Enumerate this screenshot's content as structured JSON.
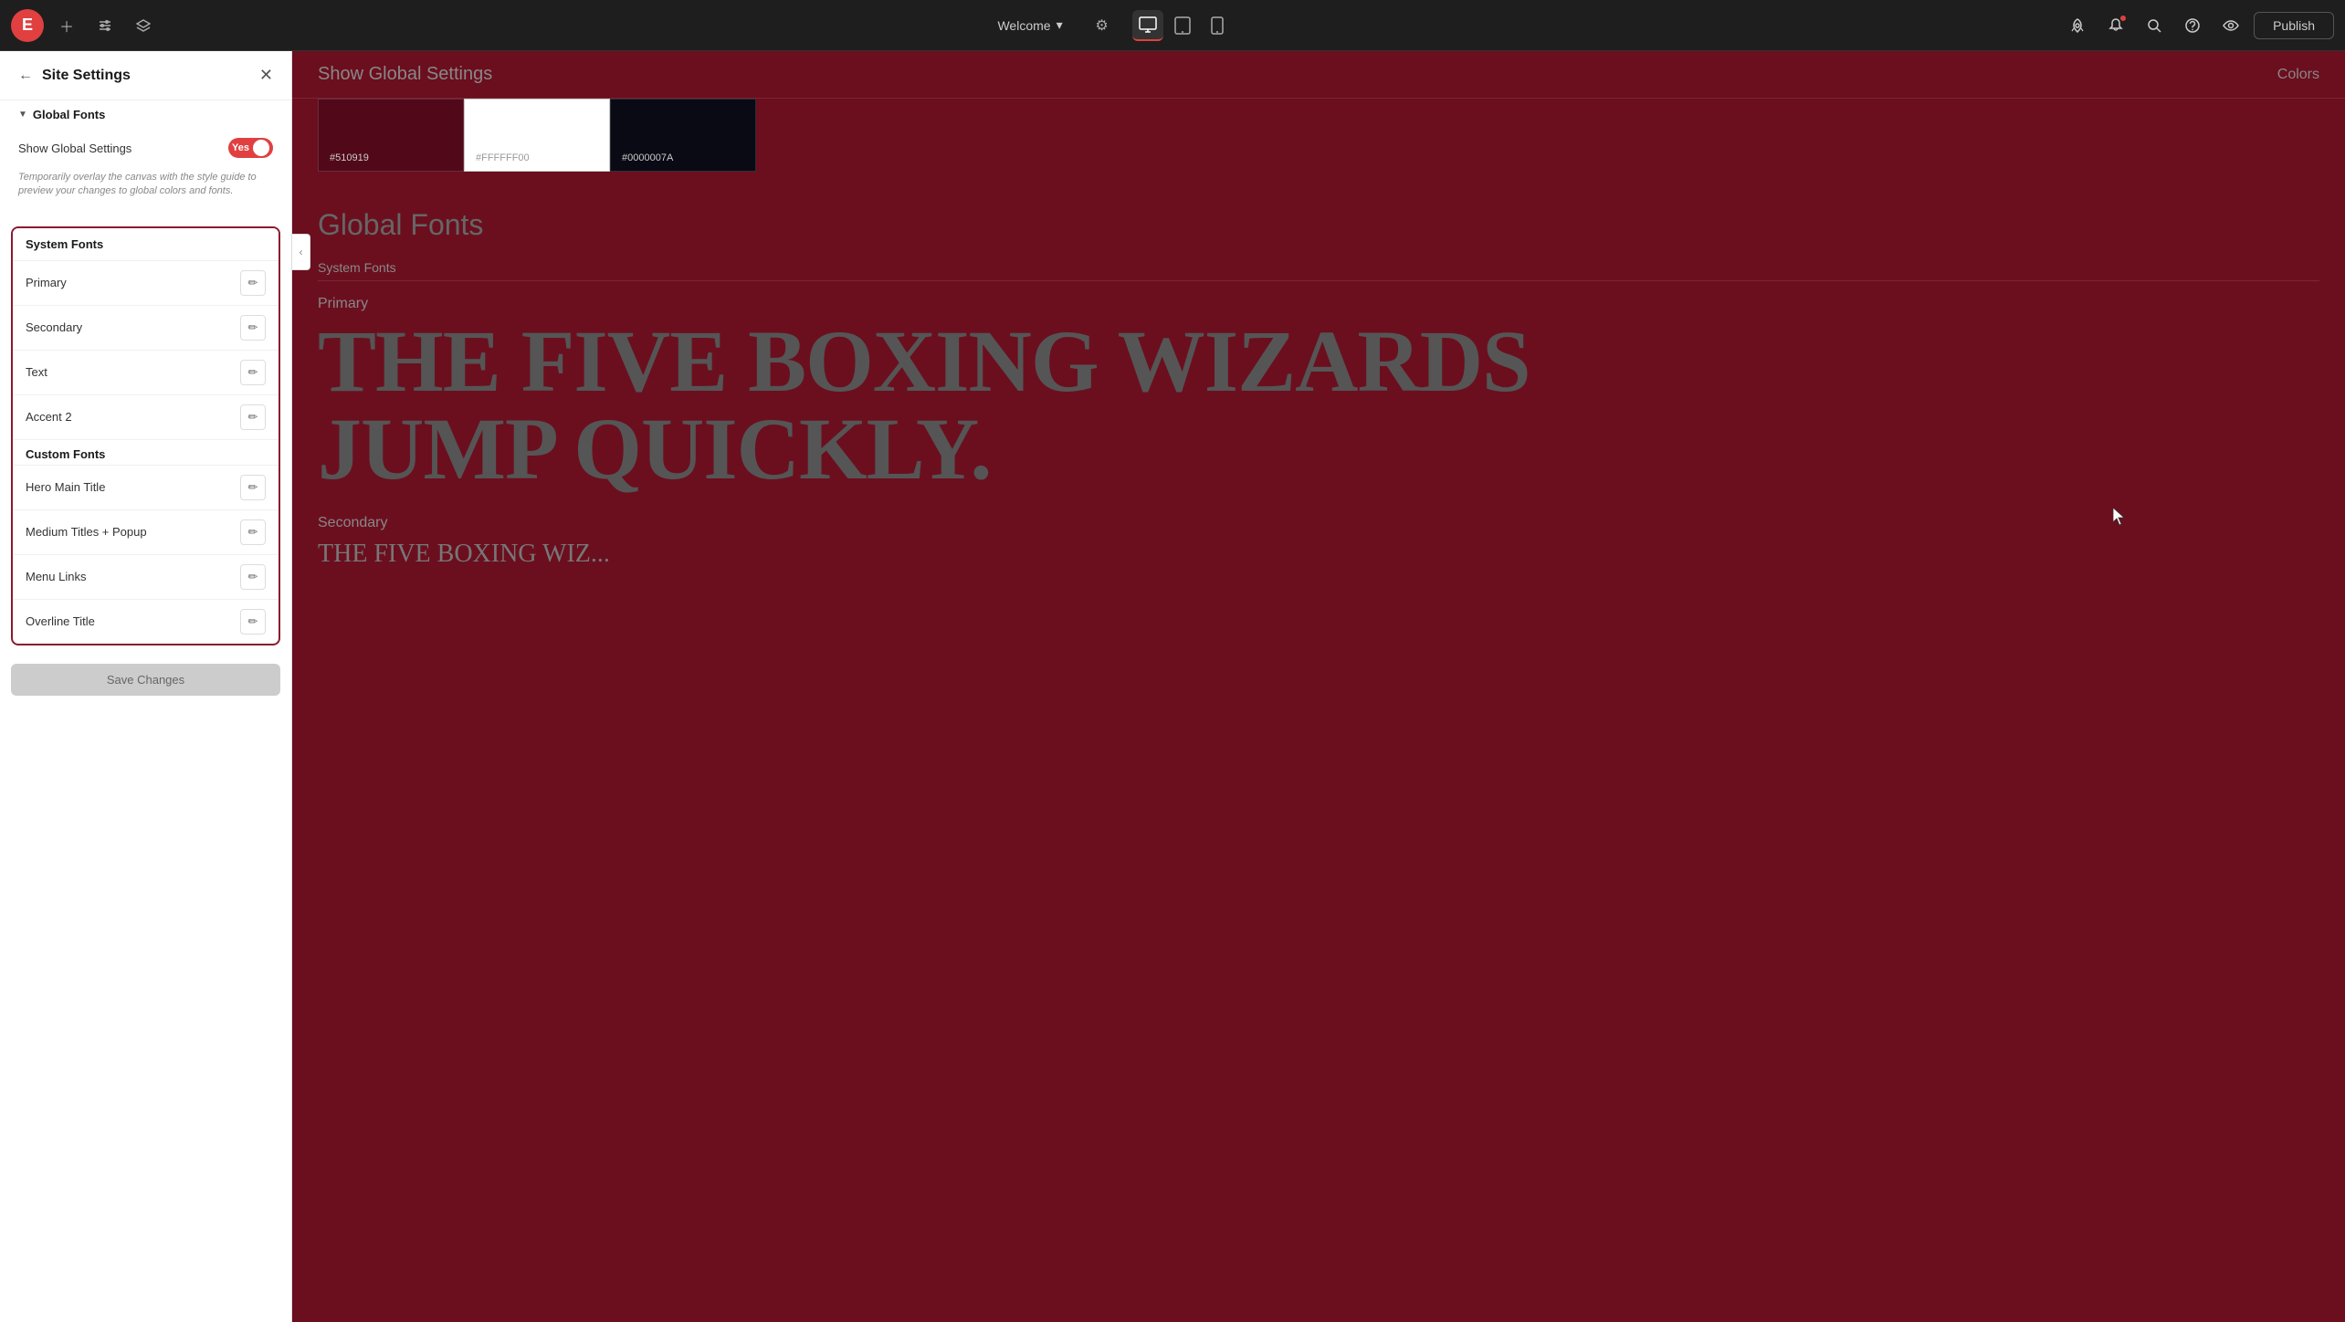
{
  "topbar": {
    "logo_icon": "E",
    "welcome_label": "Welcome",
    "publish_label": "Publish",
    "device_modes": [
      "desktop",
      "tablet",
      "mobile"
    ]
  },
  "sidebar": {
    "title": "Site Settings",
    "show_global_settings_title": "Show Global Settings",
    "show_global_toggle": "Yes",
    "toggle_hint": "Temporarily overlay the canvas with the style guide to preview your changes to global colors and fonts.",
    "global_fonts_section_label": "Global Fonts",
    "system_fonts_label": "System Fonts",
    "custom_fonts_label": "Custom Fonts",
    "system_fonts": [
      {
        "name": "Primary"
      },
      {
        "name": "Secondary"
      },
      {
        "name": "Text"
      },
      {
        "name": "Accent 2"
      }
    ],
    "custom_fonts": [
      {
        "name": "Hero Main Title"
      },
      {
        "name": "Medium Titles + Popup"
      },
      {
        "name": "Menu Links"
      },
      {
        "name": "Overline Title"
      }
    ],
    "save_btn_label": "Save Changes"
  },
  "canvas": {
    "header_title": "Show Global Settings",
    "colors_link": "Colors",
    "color_swatches": [
      {
        "label": "#510919",
        "bg": "#510919"
      },
      {
        "label": "#FFFFFF00",
        "bg": "#ffffff"
      },
      {
        "label": "#0000007A",
        "bg": "#0a0a20"
      }
    ],
    "global_fonts_heading": "Global Fonts",
    "system_fonts_label": "System Fonts",
    "primary_label": "Primary",
    "primary_sample": "THE FIVE BOXING WIZARDS JUMP QUICKLY.",
    "secondary_label": "Secondary",
    "secondary_sample": "THE FIVE BOXING WIZ..."
  }
}
